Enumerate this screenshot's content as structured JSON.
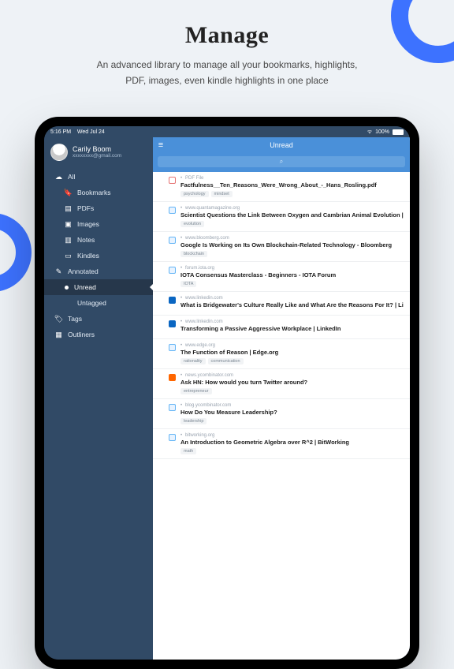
{
  "hero": {
    "title": "Manage",
    "line1": "An advanced library to manage all your bookmarks, highlights,",
    "line2": "PDF, images, even kindle highlights in one place"
  },
  "statusbar": {
    "time": "5:16 PM",
    "date": "Wed Jul 24",
    "wifi": "􀙇",
    "battery_pct": "100%"
  },
  "profile": {
    "name": "Carily Boom",
    "email": "xxxxxxxx@gmail.com"
  },
  "nav": {
    "all": "All",
    "bookmarks": "Bookmarks",
    "pdfs": "PDFs",
    "images": "Images",
    "notes": "Notes",
    "kindles": "Kindles",
    "annotated": "Annotated",
    "unread": "Unread",
    "untagged": "Untagged",
    "tags": "Tags",
    "outliners": "Outliners"
  },
  "header": {
    "title": "Unread",
    "search_icon": "⌕"
  },
  "items": [
    {
      "dot": "",
      "icon_bg": "",
      "icon_border": "#e57373",
      "source": "PDF File",
      "title": "Factfulness__Ten_Reasons_Were_Wrong_About_-_Hans_Rosling.pdf",
      "tags": [
        "psychology",
        "mindset"
      ]
    },
    {
      "dot": "",
      "icon_bg": "#e8f3ff",
      "icon_border": "#64b5f6",
      "source": "www.quantamagazine.org",
      "title": "Scientist Questions the Link Between Oxygen and Cambrian Animal Evolution | Quanta M",
      "tags": [
        "evolution"
      ]
    },
    {
      "dot": "",
      "icon_bg": "#e8f3ff",
      "icon_border": "#64b5f6",
      "source": "www.bloomberg.com",
      "title": "Google Is Working on Its Own Blockchain-Related Technology - Bloomberg",
      "tags": [
        "blockchain"
      ]
    },
    {
      "dot": "",
      "icon_bg": "#e8f3ff",
      "icon_border": "#64b5f6",
      "source": "forum.iota.org",
      "title": "IOTA Consensus Masterclass - Beginners - IOTA Forum",
      "tags": [
        "IOTA"
      ]
    },
    {
      "dot": "",
      "icon_bg": "#0a66c2",
      "icon_border": "#0a66c2",
      "source": "www.linkedin.com",
      "title": "What is Bridgewater's Culture Really Like and What Are the Reasons For It? | LinkedIn",
      "tags": []
    },
    {
      "dot": "",
      "icon_bg": "#0a66c2",
      "icon_border": "#0a66c2",
      "source": "www.linkedin.com",
      "title": "Transforming a Passive Aggressive Workplace | LinkedIn",
      "tags": []
    },
    {
      "dot": "",
      "icon_bg": "#e8f3ff",
      "icon_border": "#64b5f6",
      "source": "www.edge.org",
      "title": "The Function of Reason | Edge.org",
      "tags": [
        "rationality",
        "communication"
      ]
    },
    {
      "dot": "",
      "icon_bg": "#ff6600",
      "icon_border": "#ff6600",
      "source": "news.ycombinator.com",
      "title": "Ask HN: How would you turn Twitter around?",
      "tags": [
        "entrepreneur"
      ]
    },
    {
      "dot": "",
      "icon_bg": "#e8f3ff",
      "icon_border": "#64b5f6",
      "source": "blog.ycombinator.com",
      "title": "How Do You Measure Leadership?",
      "tags": [
        "leadership"
      ]
    },
    {
      "dot": "",
      "icon_bg": "#e8f3ff",
      "icon_border": "#64b5f6",
      "source": "bitworking.org",
      "title": "An Introduction to Geometric Algebra over R^2 | BitWorking",
      "tags": [
        "math"
      ]
    }
  ]
}
